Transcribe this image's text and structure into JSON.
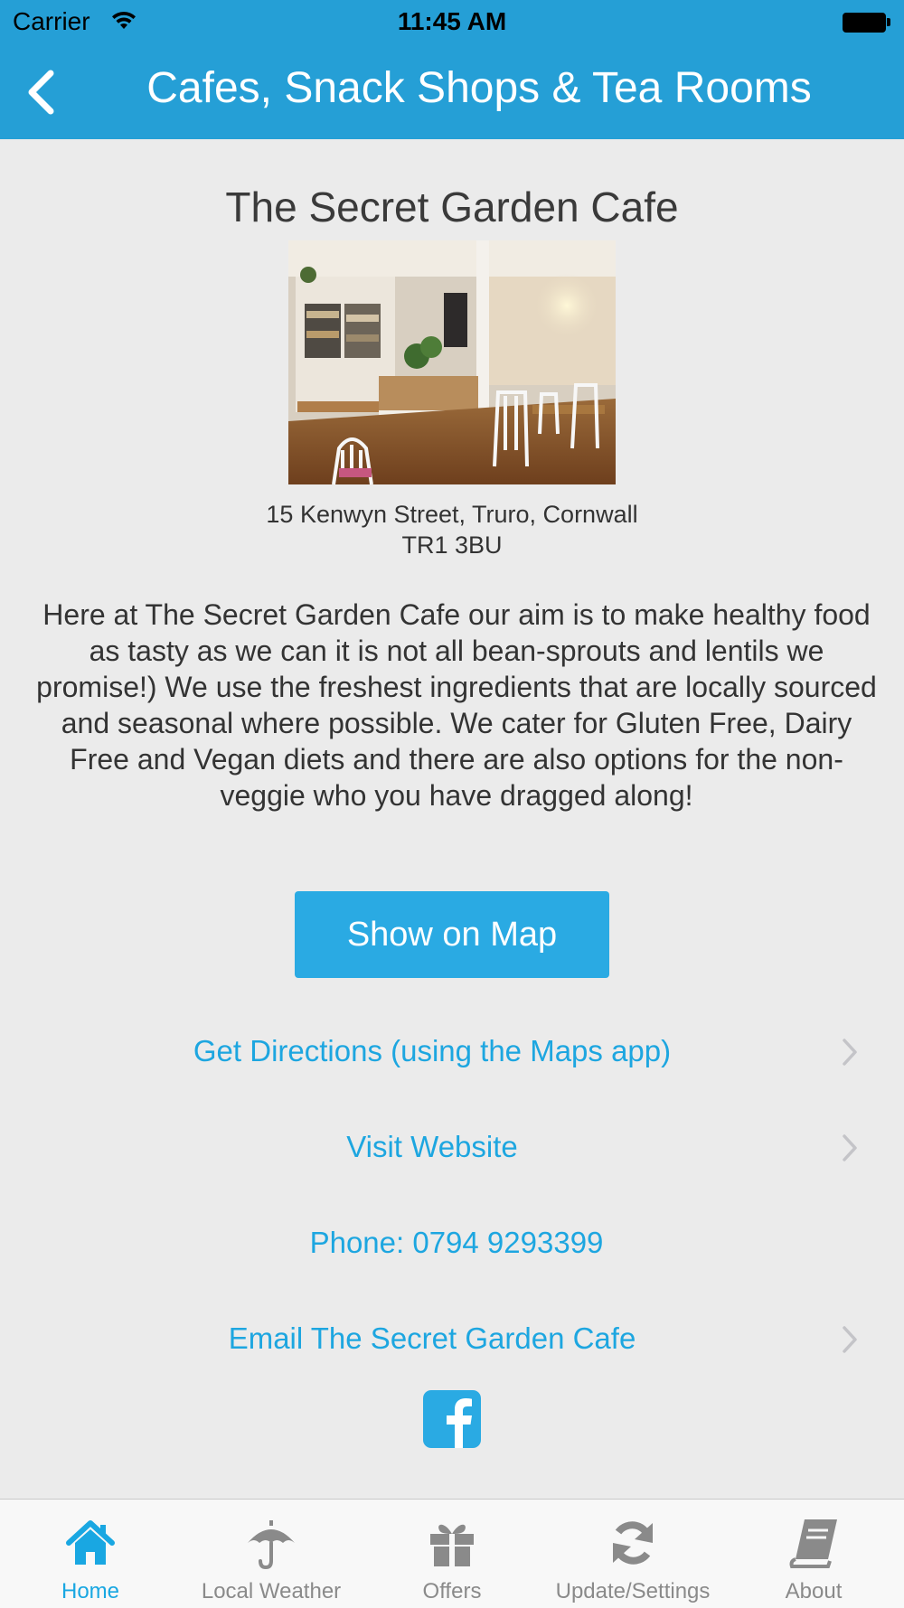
{
  "status_bar": {
    "carrier": "Carrier",
    "time": "11:45 AM"
  },
  "nav": {
    "title": "Cafes, Snack Shops & Tea Rooms"
  },
  "cafe": {
    "name": "The Secret Garden Cafe",
    "address_line1": "15 Kenwyn Street, Truro, Cornwall",
    "address_line2": "TR1 3BU",
    "description": "Here at The Secret Garden Cafe our aim is to make healthy food as tasty as we can it is not all bean-sprouts and lentils we promise!) We use the freshest ingredients that are locally sourced and seasonal where possible. We cater for Gluten Free, Dairy Free and Vegan diets and there are also options for the non-veggie who you have dragged along!"
  },
  "actions": {
    "show_map": "Show on Map",
    "directions": "Get Directions (using the Maps app)",
    "website": "Visit Website",
    "phone": "Phone: 0794 9293399",
    "email": "Email The Secret Garden Cafe"
  },
  "tabs": [
    {
      "label": "Home",
      "icon": "home-icon",
      "active": true
    },
    {
      "label": "Local Weather",
      "icon": "umbrella-icon",
      "active": false
    },
    {
      "label": "Offers",
      "icon": "gift-icon",
      "active": false
    },
    {
      "label": "Update/Settings",
      "icon": "refresh-icon",
      "active": false
    },
    {
      "label": "About",
      "icon": "book-icon",
      "active": false
    }
  ],
  "colors": {
    "accent": "#259fd6",
    "link": "#1da6e0",
    "button": "#2aaae3",
    "background": "#ebebeb",
    "tab_active": "#19a7e2",
    "tab_inactive": "#8a8a8a"
  }
}
